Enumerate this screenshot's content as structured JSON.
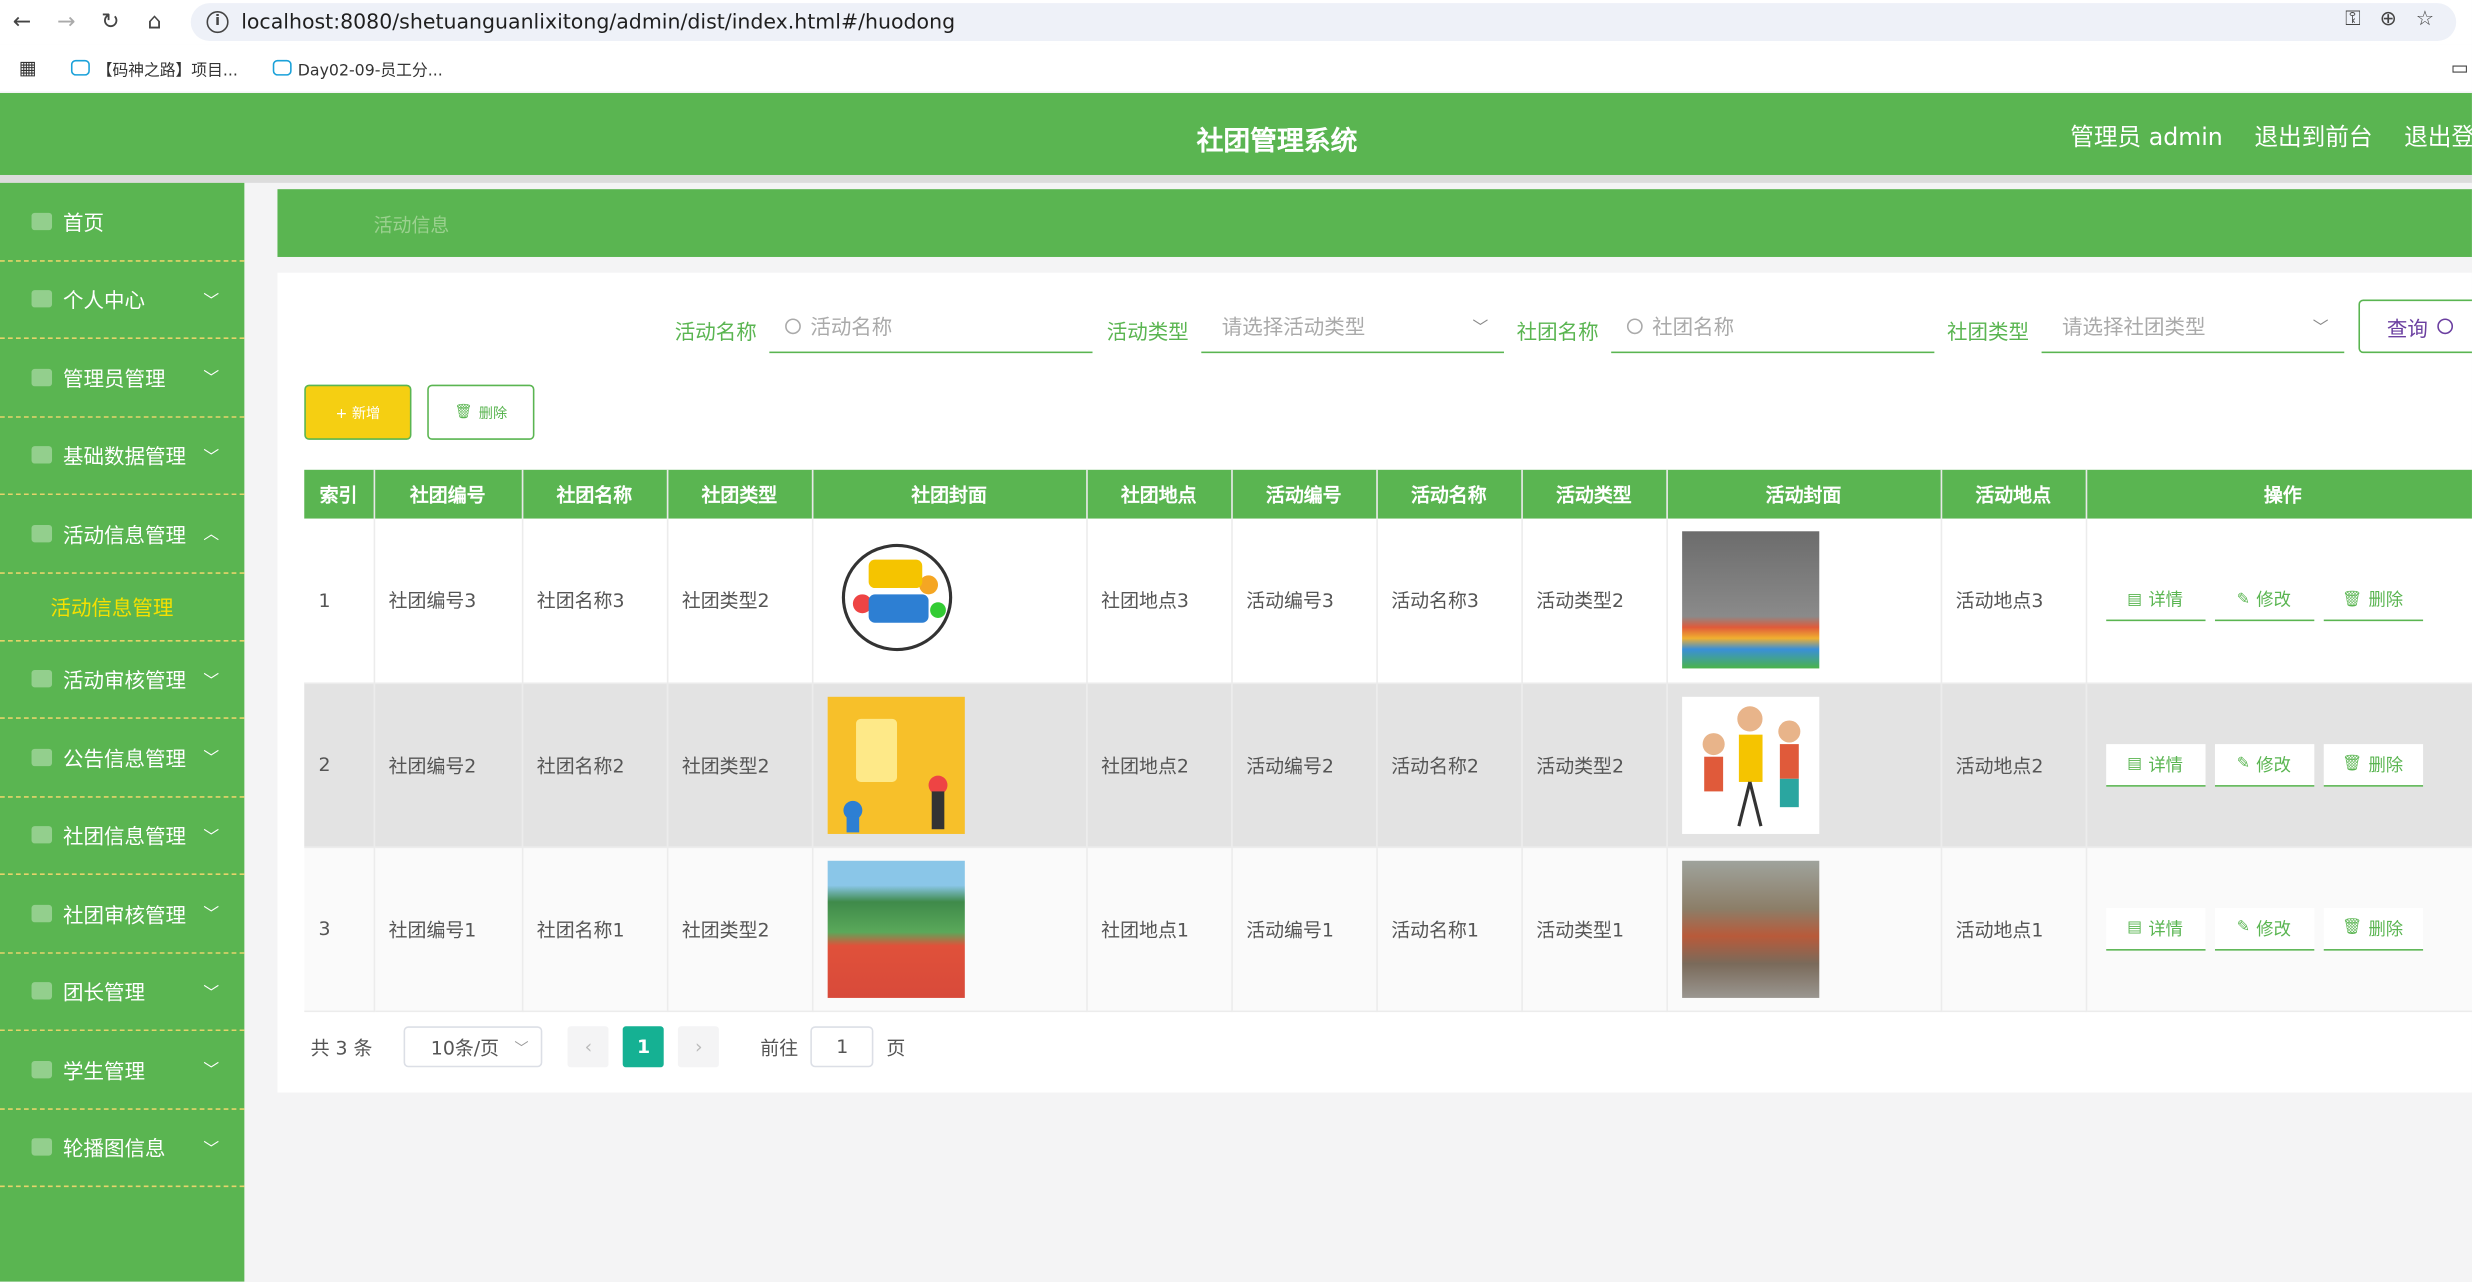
{
  "browser": {
    "url": "localhost:8080/shetuanguanlixitong/admin/dist/index.html#/huodong",
    "bookmarks": [
      "【码神之路】项目...",
      "Day02-09-员工分..."
    ]
  },
  "header": {
    "title": "社团管理系统",
    "user": "管理员 admin",
    "front": "退出到前台",
    "logout": "退出登"
  },
  "sidebar": {
    "items": [
      {
        "label": "首页"
      },
      {
        "label": "个人中心"
      },
      {
        "label": "管理员管理"
      },
      {
        "label": "基础数据管理"
      },
      {
        "label": "活动信息管理"
      },
      {
        "label": "活动信息管理"
      },
      {
        "label": "活动审核管理"
      },
      {
        "label": "公告信息管理"
      },
      {
        "label": "社团信息管理"
      },
      {
        "label": "社团审核管理"
      },
      {
        "label": "团长管理"
      },
      {
        "label": "学生管理"
      },
      {
        "label": "轮播图信息"
      }
    ]
  },
  "breadcrumb": "活动信息",
  "search": {
    "activity_name_label": "活动名称",
    "activity_name_placeholder": "活动名称",
    "activity_type_label": "活动类型",
    "activity_type_placeholder": "请选择活动类型",
    "club_name_label": "社团名称",
    "club_name_placeholder": "社团名称",
    "club_type_label": "社团类型",
    "club_type_placeholder": "请选择社团类型",
    "query": "查询"
  },
  "toolbar": {
    "add": "+ 新增",
    "delete": "删除"
  },
  "table": {
    "headers": [
      "索引",
      "社团编号",
      "社团名称",
      "社团类型",
      "社团封面",
      "社团地点",
      "活动编号",
      "活动名称",
      "活动类型",
      "活动封面",
      "活动地点",
      "操作"
    ],
    "rows": [
      {
        "idx": "1",
        "club_no": "社团编号3",
        "club_name": "社团名称3",
        "club_type": "社团类型2",
        "club_loc": "社团地点3",
        "act_no": "活动编号3",
        "act_name": "活动名称3",
        "act_type": "活动类型2",
        "act_loc": "活动地点3"
      },
      {
        "idx": "2",
        "club_no": "社团编号2",
        "club_name": "社团名称2",
        "club_type": "社团类型2",
        "club_loc": "社团地点2",
        "act_no": "活动编号2",
        "act_name": "活动名称2",
        "act_type": "活动类型2",
        "act_loc": "活动地点2"
      },
      {
        "idx": "3",
        "club_no": "社团编号1",
        "club_name": "社团名称1",
        "club_type": "社团类型2",
        "club_loc": "社团地点1",
        "act_no": "活动编号1",
        "act_name": "活动名称1",
        "act_type": "活动类型1",
        "act_loc": "活动地点1"
      }
    ],
    "ops": {
      "detail": "详情",
      "edit": "修改",
      "delete": "删除"
    }
  },
  "pager": {
    "total": "共 3 条",
    "page_size": "10条/页",
    "current": "1",
    "goto_label": "前往",
    "goto_value": "1",
    "page_suffix": "页"
  },
  "colors": {
    "primary": "#5ab551",
    "accent": "#f5cf12",
    "pager_active": "#15b193"
  }
}
